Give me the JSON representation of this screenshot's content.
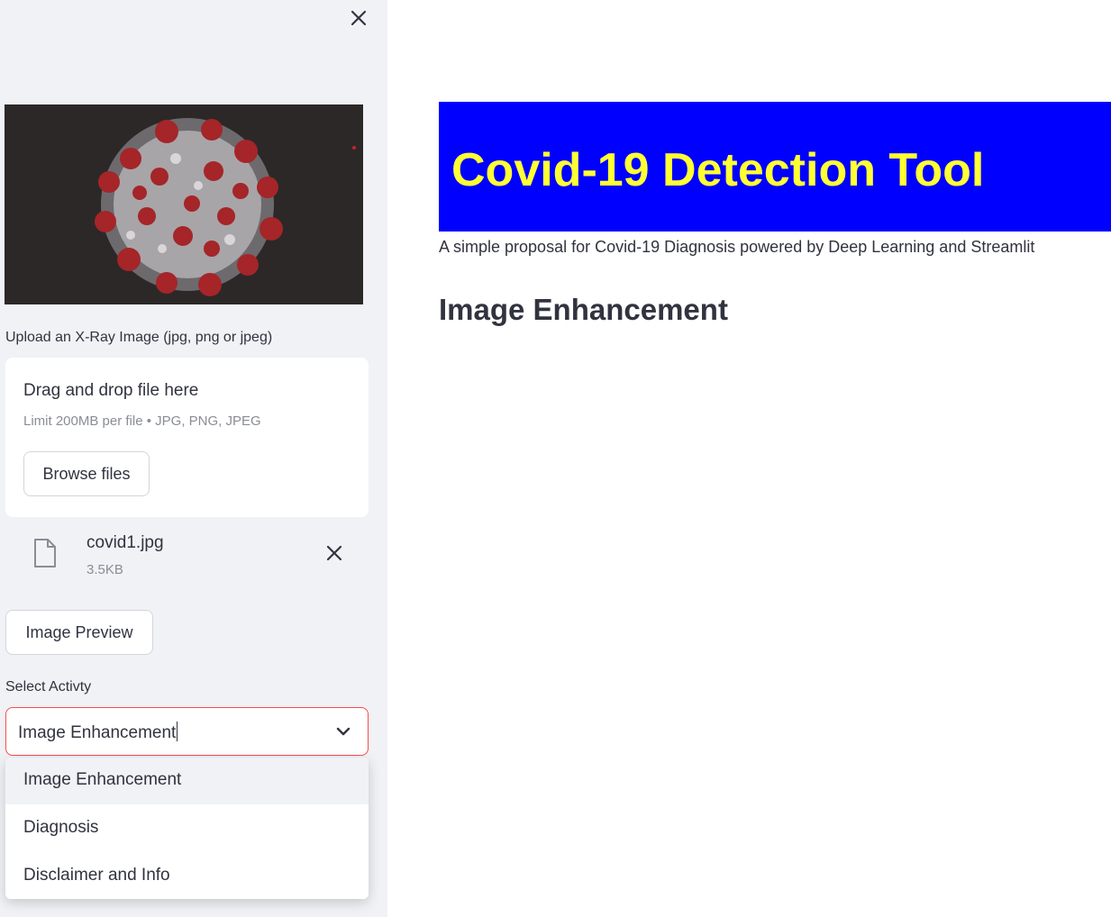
{
  "sidebar": {
    "upload_label": "Upload an X-Ray Image (jpg, png or jpeg)",
    "dropzone": {
      "title": "Drag and drop file here",
      "limit": "Limit 200MB per file • JPG, PNG, JPEG",
      "browse_label": "Browse files"
    },
    "uploaded_file": {
      "name": "covid1.jpg",
      "size": "3.5KB"
    },
    "preview_button": "Image Preview",
    "select_label": "Select Activty",
    "select_value": "Image Enhancement",
    "options": [
      "Image Enhancement",
      "Diagnosis",
      "Disclaimer and Info"
    ]
  },
  "main": {
    "title": "Covid-19 Detection Tool",
    "subtitle": "A simple proposal for Covid-19 Diagnosis powered by Deep Learning and Streamlit",
    "section_heading": "Image Enhancement"
  },
  "colors": {
    "banner_bg": "#0000ff",
    "title_text": "#ffff33",
    "select_border": "#ff4b4b",
    "sidebar_bg": "#f0f2f6"
  },
  "icons": {
    "close": "close-icon",
    "file": "file-icon",
    "remove": "close-icon",
    "dropdown": "chevron-down-icon"
  }
}
